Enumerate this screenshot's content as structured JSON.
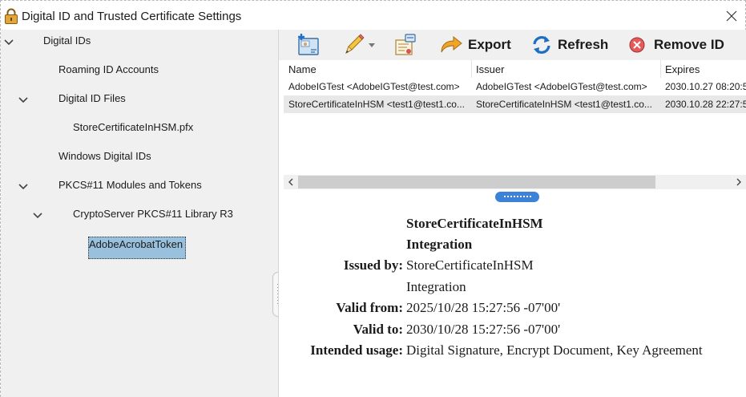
{
  "window": {
    "title": "Digital ID and Trusted Certificate Settings"
  },
  "tree": {
    "digital_ids": "Digital IDs",
    "roaming_id_accounts": "Roaming ID Accounts",
    "digital_id_files": "Digital ID Files",
    "store_file": "StoreCertificateInHSM.pfx",
    "windows_digital_ids": "Windows Digital IDs",
    "pkcs11_modules": "PKCS#11 Modules and Tokens",
    "cryptoserver_library": "CryptoServer PKCS#11 Library R3",
    "acrobat_token": "AdobeAcrobatToken"
  },
  "toolbar": {
    "export_label": "Export",
    "refresh_label": "Refresh",
    "remove_label": "Remove ID"
  },
  "table": {
    "columns": [
      "Name",
      "Issuer",
      "Expires"
    ],
    "rows": [
      {
        "name": "AdobeIGTest <AdobeIGTest@test.com>",
        "issuer": "AdobeIGTest <AdobeIGTest@test.com>",
        "expires": "2030.10.27 08:20:5"
      },
      {
        "name": "StoreCertificateInHSM <test1@test1.co...",
        "issuer": "StoreCertificateInHSM <test1@test1.co...",
        "expires": "2030.10.28 22:27:5"
      }
    ]
  },
  "details": {
    "name_line1": "StoreCertificateInHSM",
    "name_line2": "Integration",
    "issued_by_label": "Issued by:",
    "issued_by_line1": "StoreCertificateInHSM",
    "issued_by_line2": "Integration",
    "valid_from_label": "Valid from:",
    "valid_from": "2025/10/28 15:27:56 -07'00'",
    "valid_to_label": "Valid to:",
    "valid_to": "2030/10/28 15:27:56 -07'00'",
    "usage_label": "Intended usage:",
    "usage": "Digital Signature, Encrypt Document, Key Agreement"
  },
  "colors": {
    "selection": "#99c1dd",
    "pane_handle": "#3c82d6",
    "left_pane_bg": "#f0f0f0"
  }
}
